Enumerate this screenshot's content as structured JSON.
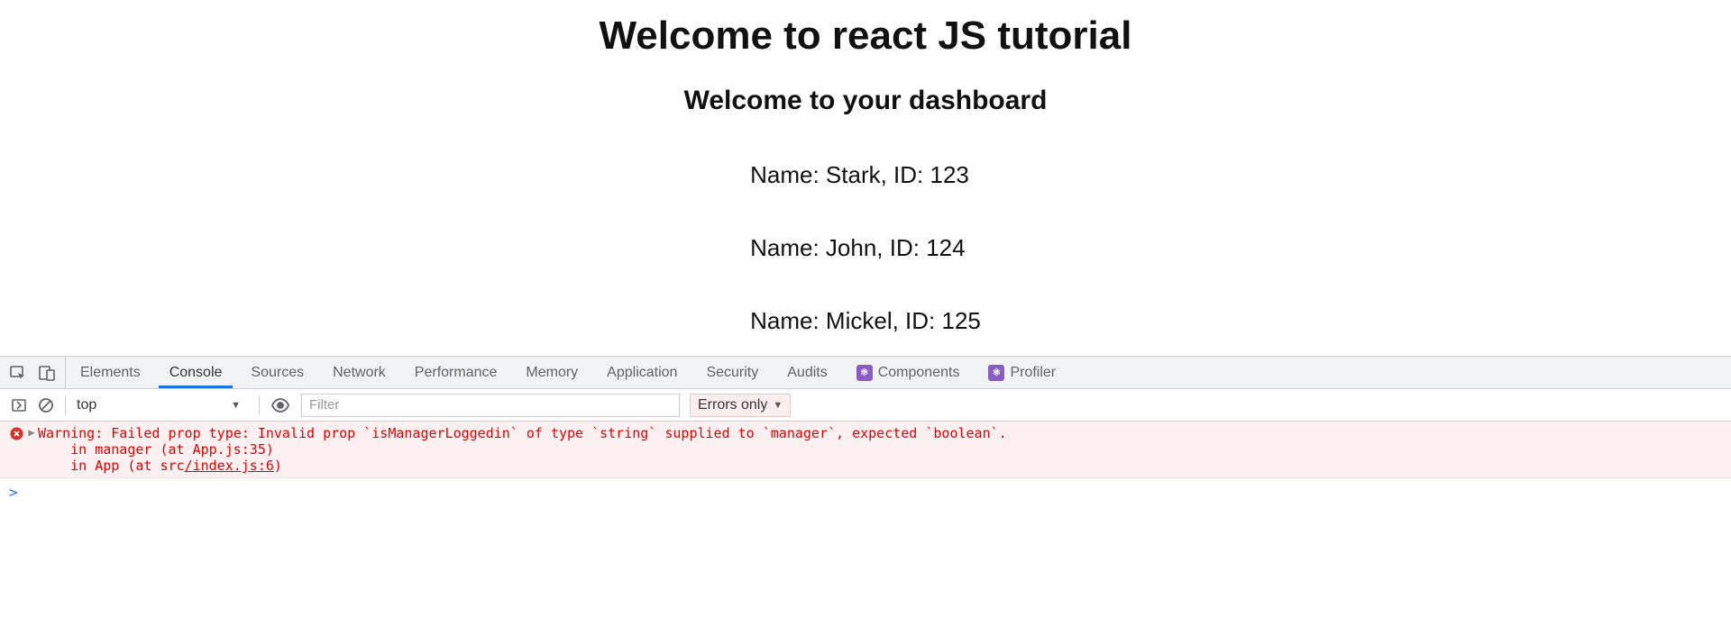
{
  "page": {
    "title": "Welcome to react JS tutorial",
    "subtitle": "Welcome to your dashboard",
    "employees": [
      {
        "name": "Stark",
        "id": "123"
      },
      {
        "name": "John",
        "id": "124"
      },
      {
        "name": "Mickel",
        "id": "125"
      }
    ],
    "name_prefix": "Name: ",
    "id_prefix": ", ID: "
  },
  "devtools": {
    "tabs": [
      {
        "label": "Elements",
        "active": false,
        "icon": null
      },
      {
        "label": "Console",
        "active": true,
        "icon": null
      },
      {
        "label": "Sources",
        "active": false,
        "icon": null
      },
      {
        "label": "Network",
        "active": false,
        "icon": null
      },
      {
        "label": "Performance",
        "active": false,
        "icon": null
      },
      {
        "label": "Memory",
        "active": false,
        "icon": null
      },
      {
        "label": "Application",
        "active": false,
        "icon": null
      },
      {
        "label": "Security",
        "active": false,
        "icon": null
      },
      {
        "label": "Audits",
        "active": false,
        "icon": null
      },
      {
        "label": "Components",
        "active": false,
        "icon": "react"
      },
      {
        "label": "Profiler",
        "active": false,
        "icon": "react"
      }
    ],
    "toolbar": {
      "context": "top",
      "filter_placeholder": "Filter",
      "level": "Errors only"
    },
    "logs": [
      {
        "type": "error",
        "line1": "Warning: Failed prop type: Invalid prop `isManagerLoggedin` of type `string` supplied to `manager`, expected `boolean`.",
        "line2": "    in manager (at App.js:35)",
        "line3_a": "    in App (at src",
        "line3_u": "/index.js:6",
        "line3_b": ")"
      }
    ],
    "prompt": ">"
  }
}
